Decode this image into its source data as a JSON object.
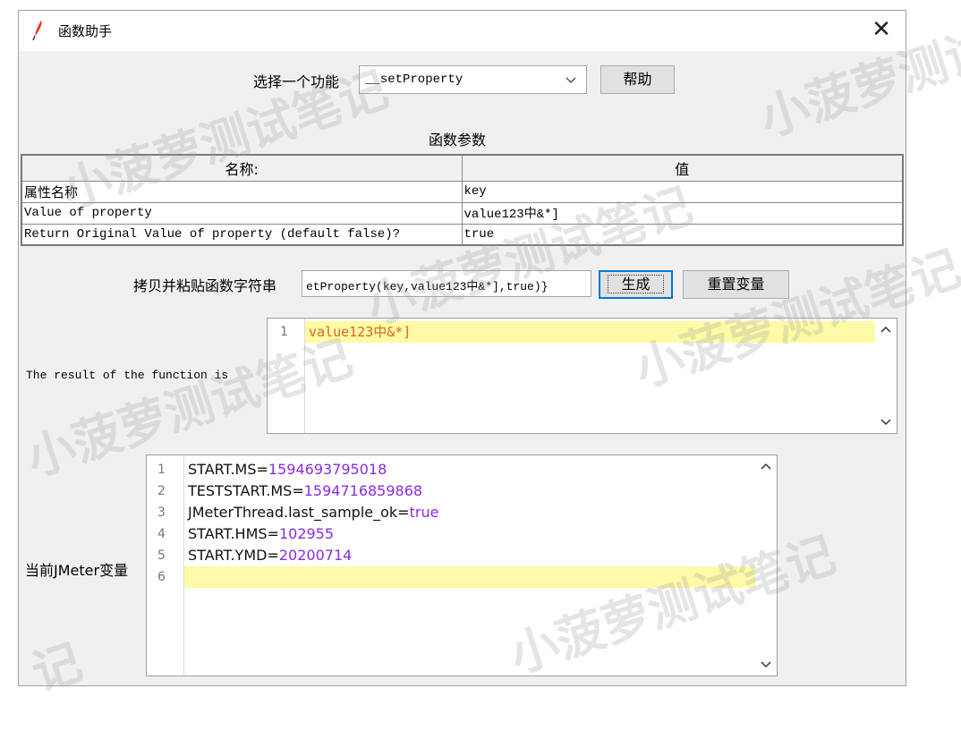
{
  "window": {
    "title": "函数助手",
    "close_glyph": "✕"
  },
  "function_select": {
    "label": "选择一个功能",
    "value": "__setProperty",
    "help_button": "帮助"
  },
  "params": {
    "section_title": "函数参数",
    "headers": [
      "名称:",
      "值"
    ],
    "rows": [
      {
        "name": "属性名称",
        "value": "key"
      },
      {
        "name": "Value of property",
        "value": "value123中&*]"
      },
      {
        "name": "Return Original Value of property (default false)?",
        "value": "true"
      }
    ]
  },
  "copy": {
    "label": "拷贝并粘贴函数字符串",
    "value": "etProperty(key,value123中&*],true)}",
    "generate_button": "生成",
    "reset_button": "重置变量"
  },
  "result": {
    "label": "The result of the function is",
    "lines": [
      {
        "num": "1",
        "text": "value123中&*]"
      }
    ]
  },
  "variables": {
    "label": "当前JMeter变量",
    "lines": [
      {
        "num": "1",
        "key": "START.MS=",
        "value": "1594693795018"
      },
      {
        "num": "2",
        "key": "TESTSTART.MS=",
        "value": "1594716859868"
      },
      {
        "num": "3",
        "key": "JMeterThread.last_sample_ok=",
        "value": "true"
      },
      {
        "num": "4",
        "key": "START.HMS=",
        "value": "102955"
      },
      {
        "num": "5",
        "key": "START.YMD=",
        "value": "20200714"
      },
      {
        "num": "6",
        "key": "",
        "value": ""
      }
    ]
  },
  "watermark_text": "小菠萝测试笔记",
  "watermark_short": "记",
  "icons": {
    "app": "feather-pen-icon",
    "scroll_up": "▲",
    "scroll_down": "▼",
    "dropdown": "chevron-down-icon"
  },
  "colors": {
    "number": "#8a2be2",
    "result_text": "#d2691e",
    "current_line": "#fefaa6",
    "focus_border": "#0078d7"
  }
}
